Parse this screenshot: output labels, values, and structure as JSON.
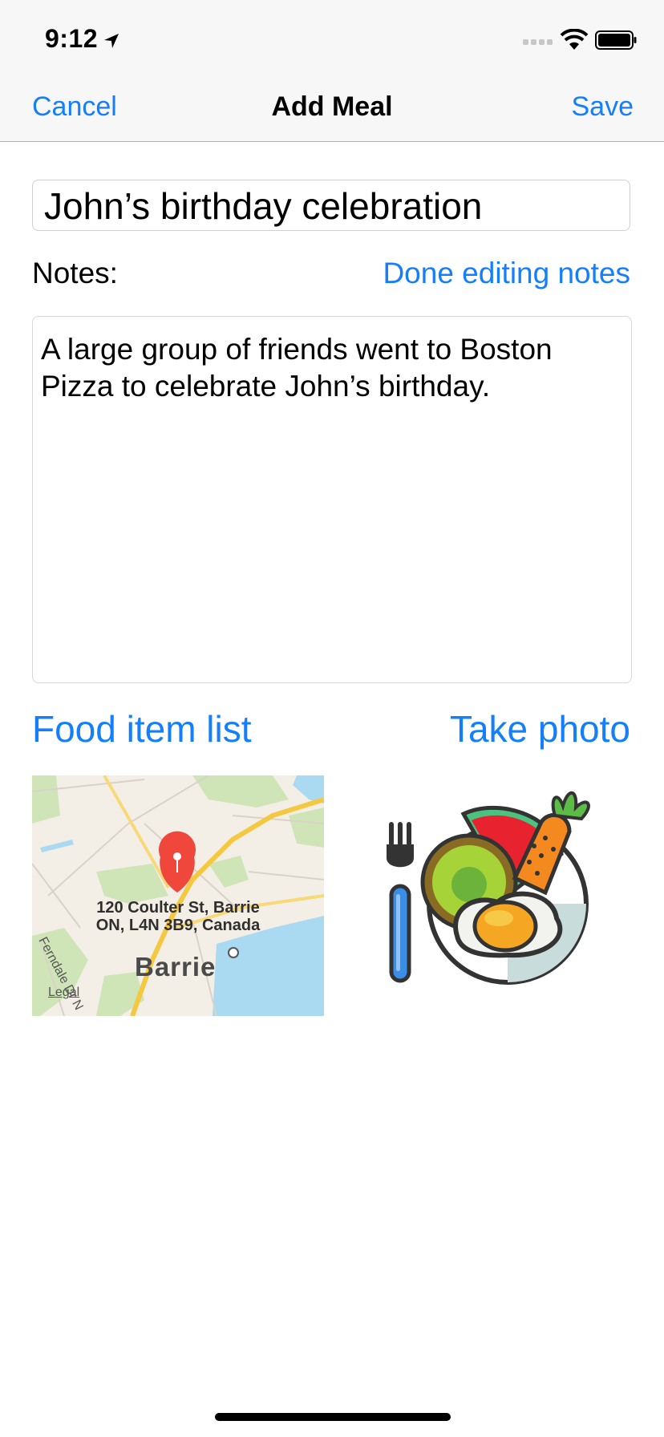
{
  "status": {
    "time": "9:12"
  },
  "nav": {
    "cancel": "Cancel",
    "title": "Add Meal",
    "save": "Save"
  },
  "form": {
    "meal_name": "John’s birthday celebration",
    "notes_label": "Notes:",
    "done_notes": "Done editing notes",
    "notes_text": "A large group of friends went to Boston Pizza to celebrate John’s birthday."
  },
  "links": {
    "food_list": "Food item list",
    "take_photo": "Take photo"
  },
  "map": {
    "address_line1": "120 Coulter St, Barrie",
    "address_line2": "ON, L4N 3B9, Canada",
    "city": "Barrie",
    "legal": "Legal",
    "street": "Ferndale Dr N"
  },
  "icons": {
    "location": "location-arrow-icon",
    "signal": "cellular-signal-icon",
    "wifi": "wifi-icon",
    "battery": "battery-icon",
    "pin": "map-pin-icon",
    "meal": "meal-plate-icon"
  },
  "colors": {
    "accent": "#147efb",
    "pin": "#f0473c",
    "water": "#aadaf2"
  }
}
